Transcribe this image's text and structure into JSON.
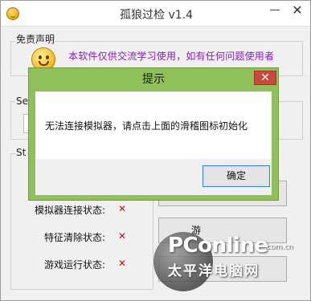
{
  "window": {
    "title": "孤狼过检 v1.4",
    "minimize_glyph": "—",
    "close_glyph": "✕"
  },
  "disclaimer": {
    "group_label": "免责声明",
    "text": "本软件仅供交流学习使用，如有任何问题使用者"
  },
  "settings": {
    "group_label_partial": "Se"
  },
  "status": {
    "group_label_partial": "St",
    "rows": [
      {
        "label": "模拟器连接状态:",
        "state": "✕"
      },
      {
        "label": "特征清除状态:",
        "state": "✕"
      },
      {
        "label": "游戏运行状态:",
        "state": "✕"
      }
    ],
    "partial_button_text": "游"
  },
  "dialog": {
    "title": "提示",
    "close_glyph": "✕",
    "message": "无法连接模拟器，请点击上面的滑稽图标初始化",
    "ok_label": "确定"
  },
  "watermark": {
    "brand": "PConline",
    "domain": ".com.cn",
    "tagline": "太平洋电脑网"
  },
  "colors": {
    "accent_dialog": "#8fc05a",
    "disclaimer_text": "#8a1bc4",
    "status_x": "#d01414"
  }
}
